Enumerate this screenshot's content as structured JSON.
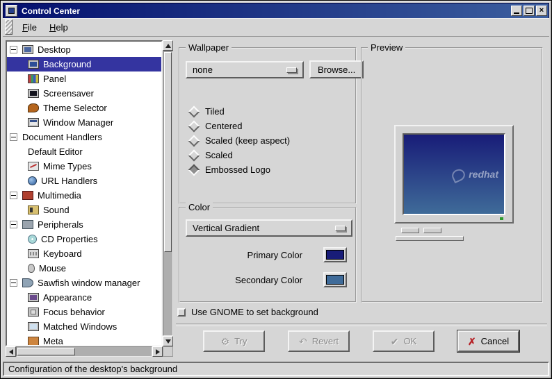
{
  "window": {
    "title": "Control Center"
  },
  "menubar": {
    "items": [
      {
        "label": "File"
      },
      {
        "label": "Help"
      }
    ]
  },
  "tree": {
    "items": [
      {
        "label": "Desktop",
        "level": 0,
        "expander": true,
        "icon": "desktop-icon",
        "selected": false
      },
      {
        "label": "Background",
        "level": 1,
        "expander": false,
        "icon": "background-icon",
        "selected": true
      },
      {
        "label": "Panel",
        "level": 1,
        "expander": false,
        "icon": "panel-icon",
        "selected": false
      },
      {
        "label": "Screensaver",
        "level": 1,
        "expander": false,
        "icon": "screensaver-icon",
        "selected": false
      },
      {
        "label": "Theme Selector",
        "level": 1,
        "expander": false,
        "icon": "theme-selector-icon",
        "selected": false
      },
      {
        "label": "Window Manager",
        "level": 1,
        "expander": false,
        "icon": "window-manager-icon",
        "selected": false
      },
      {
        "label": "Document Handlers",
        "level": 0,
        "expander": true,
        "icon": "",
        "selected": false
      },
      {
        "label": "Default Editor",
        "level": 1,
        "expander": false,
        "icon": "",
        "selected": false
      },
      {
        "label": "Mime Types",
        "level": 1,
        "expander": false,
        "icon": "mime-types-icon",
        "selected": false
      },
      {
        "label": "URL Handlers",
        "level": 1,
        "expander": false,
        "icon": "url-handlers-icon",
        "selected": false
      },
      {
        "label": "Multimedia",
        "level": 0,
        "expander": true,
        "icon": "multimedia-icon",
        "selected": false
      },
      {
        "label": "Sound",
        "level": 1,
        "expander": false,
        "icon": "sound-icon",
        "selected": false
      },
      {
        "label": "Peripherals",
        "level": 0,
        "expander": true,
        "icon": "peripherals-icon",
        "selected": false
      },
      {
        "label": "CD Properties",
        "level": 1,
        "expander": false,
        "icon": "cd-properties-icon",
        "selected": false
      },
      {
        "label": "Keyboard",
        "level": 1,
        "expander": false,
        "icon": "keyboard-icon",
        "selected": false
      },
      {
        "label": "Mouse",
        "level": 1,
        "expander": false,
        "icon": "mouse-icon",
        "selected": false
      },
      {
        "label": "Sawfish window manager",
        "level": 0,
        "expander": true,
        "icon": "sawfish-icon",
        "selected": false
      },
      {
        "label": "Appearance",
        "level": 1,
        "expander": false,
        "icon": "appearance-icon",
        "selected": false
      },
      {
        "label": "Focus behavior",
        "level": 1,
        "expander": false,
        "icon": "focus-behavior-icon",
        "selected": false
      },
      {
        "label": "Matched Windows",
        "level": 1,
        "expander": false,
        "icon": "matched-windows-icon",
        "selected": false
      },
      {
        "label": "Meta",
        "level": 1,
        "expander": false,
        "icon": "meta-icon",
        "selected": false
      }
    ]
  },
  "wallpaper": {
    "title": "Wallpaper",
    "file_dropdown": {
      "value": "none"
    },
    "browse_button": "Browse...",
    "layout_options": [
      {
        "label": "Tiled",
        "selected": false
      },
      {
        "label": "Centered",
        "selected": false
      },
      {
        "label": "Scaled (keep aspect)",
        "selected": false
      },
      {
        "label": "Scaled",
        "selected": false
      },
      {
        "label": "Embossed Logo",
        "selected": true
      }
    ]
  },
  "color": {
    "title": "Color",
    "gradient_dropdown": {
      "value": "Vertical Gradient"
    },
    "primary": {
      "label": "Primary Color",
      "hex": "#181c78"
    },
    "secondary": {
      "label": "Secondary Color",
      "hex": "#3f6b99"
    }
  },
  "preview": {
    "title": "Preview",
    "watermark": "redhat"
  },
  "gnome_checkbox": {
    "label": "Use GNOME to set background",
    "checked": false
  },
  "actions": [
    {
      "label": "Try",
      "icon": "try-icon",
      "enabled": false
    },
    {
      "label": "Revert",
      "icon": "revert-icon",
      "enabled": false
    },
    {
      "label": "OK",
      "icon": "ok-icon",
      "enabled": false
    },
    {
      "label": "Cancel",
      "icon": "cancel-icon",
      "enabled": true
    }
  ],
  "statusbar": {
    "text": "Configuration of the desktop's background"
  },
  "colors": {
    "selection": "#3434a0",
    "titlebar_left": "#04106e",
    "titlebar_right": "#3c5f9f"
  }
}
